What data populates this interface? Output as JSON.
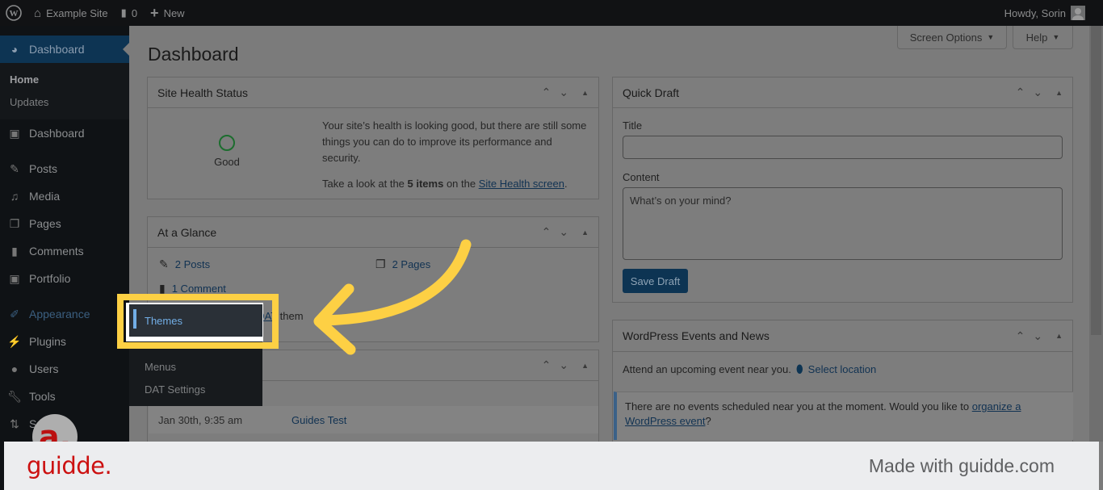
{
  "admin_bar": {
    "site_name": "Example Site",
    "comments_count": "0",
    "new_label": "New",
    "greeting": "Howdy, Sorin"
  },
  "sidebar": {
    "current": "Dashboard",
    "submenu": [
      "Home",
      "Updates"
    ],
    "items": [
      {
        "label": "Dashboard",
        "icon": "a3-icon"
      },
      {
        "label": "Posts",
        "icon": "pin-icon"
      },
      {
        "label": "Media",
        "icon": "media-icon"
      },
      {
        "label": "Pages",
        "icon": "pages-icon"
      },
      {
        "label": "Comments",
        "icon": "comment-icon"
      },
      {
        "label": "Portfolio",
        "icon": "a3-icon"
      },
      {
        "label": "Appearance",
        "icon": "brush-icon"
      },
      {
        "label": "Plugins",
        "icon": "plug-icon"
      },
      {
        "label": "Users",
        "icon": "user-icon"
      },
      {
        "label": "Tools",
        "icon": "wrench-icon"
      },
      {
        "label": "S",
        "icon": "settings-icon"
      }
    ]
  },
  "flyout": {
    "items": [
      "Themes",
      "Menus",
      "DAT Settings"
    ]
  },
  "header": {
    "title": "Dashboard",
    "screen_options": "Screen Options",
    "help": "Help"
  },
  "site_health": {
    "title": "Site Health Status",
    "status": "Good",
    "message": "Your site’s health is looking good, but there are still some things you can do to improve its performance and security.",
    "take_look_prefix": "Take a look at the ",
    "items_count": "5 items",
    "take_look_mid": " on the ",
    "link": "Site Health screen",
    "suffix": "."
  },
  "at_a_glance": {
    "title": "At a Glance",
    "posts": "2 Posts",
    "pages": "2 Pages",
    "comments": "1 Comment",
    "theme_partial": "g",
    "theme_link": "DAT",
    "theme_suffix": " them"
  },
  "activity": {
    "rows": [
      {
        "date": "Jan 30th, 9:35 am",
        "title": "Guides Test"
      }
    ]
  },
  "quick_draft": {
    "title": "Quick Draft",
    "title_label": "Title",
    "title_value": "",
    "content_label": "Content",
    "content_placeholder": "What’s on your mind?",
    "save": "Save Draft"
  },
  "events": {
    "title": "WordPress Events and News",
    "attend": "Attend an upcoming event near you.",
    "select_location": "Select location",
    "notice_prefix": "There are no events scheduled near you at the moment. Would you like to ",
    "notice_link": "organize a WordPress event",
    "notice_suffix": "?"
  },
  "guidde": {
    "logo": "guidde.",
    "badge": "a.",
    "made_with": "Made with guidde.com"
  },
  "colors": {
    "highlight": "#fdd044",
    "wp_blue": "#72aee6",
    "guidde_red": "#cc1010"
  }
}
